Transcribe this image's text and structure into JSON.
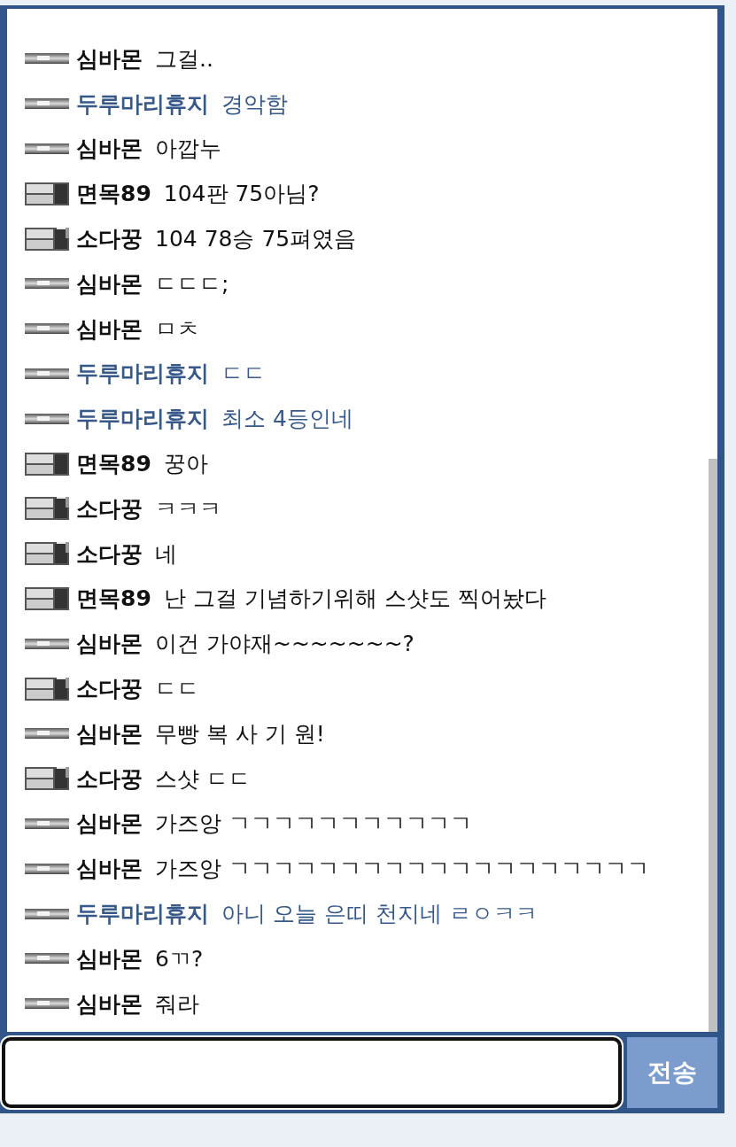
{
  "messages": [
    {
      "kind": "small",
      "name": "심바몬",
      "text": "그걸.."
    },
    {
      "kind": "small",
      "name": "두루마리휴지",
      "text": "경악함",
      "color": "#36598a"
    },
    {
      "kind": "small",
      "name": "심바몬",
      "text": "아깝누"
    },
    {
      "kind": "large",
      "name": "면목89",
      "text": "104판 75아님?"
    },
    {
      "kind": "spark",
      "name": "소다꿍",
      "text": "104 78승 75펴였음"
    },
    {
      "kind": "small",
      "name": "심바몬",
      "text": "ㄷㄷㄷ;"
    },
    {
      "kind": "small",
      "name": "심바몬",
      "text": "ㅁㅊ"
    },
    {
      "kind": "small",
      "name": "두루마리휴지",
      "text": "ㄷㄷ",
      "color": "#36598a"
    },
    {
      "kind": "small",
      "name": "두루마리휴지",
      "text": "최소 4등인네",
      "color": "#36598a"
    },
    {
      "kind": "large",
      "name": "면목89",
      "text": "꿍아"
    },
    {
      "kind": "spark",
      "name": "소다꿍",
      "text": "ㅋㅋㅋ"
    },
    {
      "kind": "spark",
      "name": "소다꿍",
      "text": "네"
    },
    {
      "kind": "large",
      "name": "면목89",
      "text": "난 그걸 기념하기위해 스샷도 찍어놨다"
    },
    {
      "kind": "small",
      "name": "심바몬",
      "text": "이건 가야재~~~~~~~?"
    },
    {
      "kind": "spark",
      "name": "소다꿍",
      "text": "ㄷㄷ"
    },
    {
      "kind": "small",
      "name": "심바몬",
      "text": "무빵 복 사 기 원!"
    },
    {
      "kind": "spark",
      "name": "소다꿍",
      "text": "스샷 ㄷㄷ"
    },
    {
      "kind": "small",
      "name": "심바몬",
      "text": "가즈앙 ㄱㄱㄱㄱㄱㄱㄱㄱㄱㄱㄱ"
    },
    {
      "kind": "small",
      "name": "심바몬",
      "text": "가즈앙 ㄱㄱㄱㄱㄱㄱㄱㄱㄱㄱㄱㄱㄱㄱㄱㄱㄱㄱㄱ"
    },
    {
      "kind": "small",
      "name": "두루마리휴지",
      "text": "아니 오늘 은띠 천지네 ㄹㅇㅋㅋ",
      "color": "#36598a"
    },
    {
      "kind": "small",
      "name": "심바몬",
      "text": "6ㄲ?"
    },
    {
      "kind": "small",
      "name": "심바몬",
      "text": "줘라"
    }
  ],
  "send_button": "전송"
}
